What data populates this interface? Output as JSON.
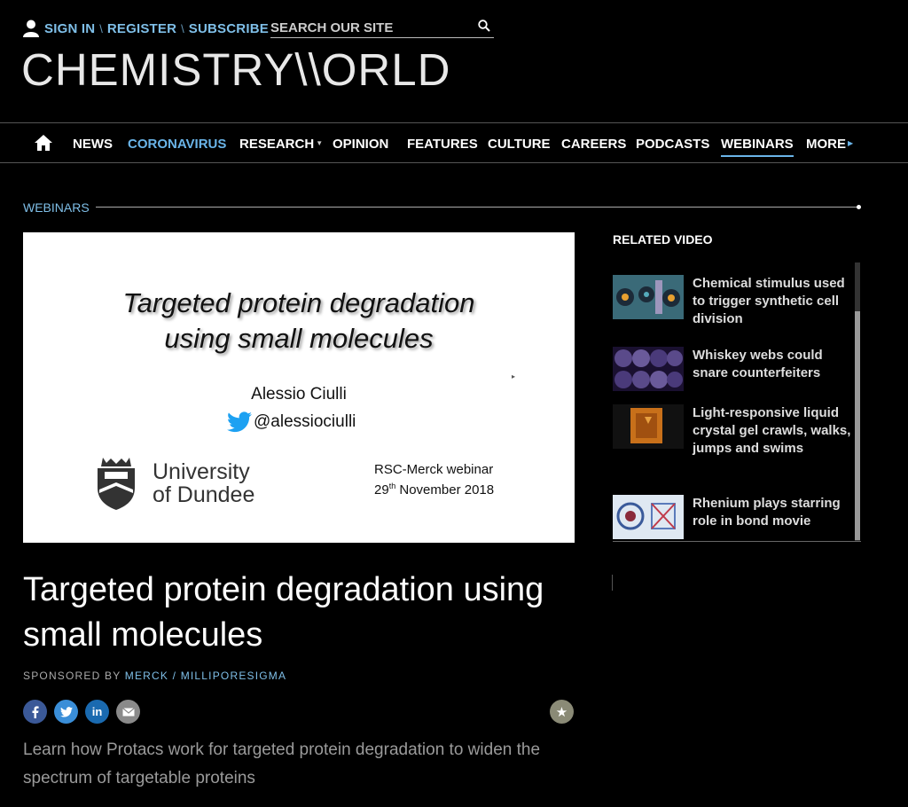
{
  "topbar": {
    "sign_in": "SIGN IN",
    "register": "REGISTER",
    "subscribe": "SUBSCRIBE",
    "search_placeholder": "SEARCH OUR SITE"
  },
  "logo": {
    "text": "CHEMISTRY\\\\ORLD"
  },
  "nav": {
    "items": [
      "NEWS",
      "CORONAVIRUS",
      "RESEARCH",
      "OPINION",
      "FEATURES",
      "CULTURE",
      "CAREERS",
      "PODCASTS",
      "WEBINARS",
      "MORE"
    ]
  },
  "section": {
    "label": "WEBINARS"
  },
  "slide": {
    "title_line1": "Targeted protein degradation",
    "title_line2": "using small molecules",
    "author": "Alessio Ciulli",
    "twitter": "@alessiociulli",
    "university_line1": "University",
    "university_line2": "of Dundee",
    "webinar_line1": "RSC-Merck webinar",
    "webinar_day": "29",
    "webinar_suffix": "th",
    "webinar_rest": " November 2018"
  },
  "related": {
    "title": "RELATED VIDEO",
    "items": [
      {
        "title": "Chemical stimulus used to trigger synthetic cell division"
      },
      {
        "title": "Whiskey webs could snare counterfeiters"
      },
      {
        "title": "Light-responsive liquid crystal gel crawls, walks, jumps and swims"
      },
      {
        "title": "Rhenium plays starring role in bond movie"
      }
    ]
  },
  "article": {
    "headline": "Targeted protein degradation using small molecules",
    "sponsored_by": "SPONSORED BY",
    "sponsor": "MERCK / MILLIPORESIGMA",
    "summary": "Learn how Protacs work for targeted protein degradation to widen the spectrum of targetable proteins"
  },
  "share": {
    "linkedin": "in"
  },
  "colors": {
    "accent": "#6ab4e8",
    "facebook": "#3b5998",
    "twitter": "#1da1f2",
    "linkedin": "#0e76a8",
    "email": "#888888"
  }
}
